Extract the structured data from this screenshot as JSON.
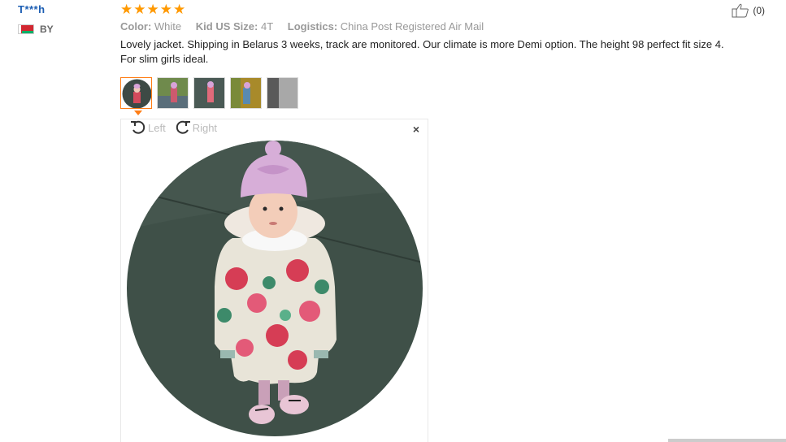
{
  "user": {
    "name": "T***h",
    "country": "BY"
  },
  "rating": {
    "stars": 5
  },
  "attributes": [
    {
      "name": "Color:",
      "value": "White"
    },
    {
      "name": "Kid US Size:",
      "value": "4T"
    },
    {
      "name": "Logistics:",
      "value": "China Post Registered Air Mail"
    }
  ],
  "feedback": {
    "line1": "Lovely jacket. Shipping in Belarus 3 weeks, track are monitored. Our climate is more Demi option. The height 98 perfect fit size 4.",
    "line2": "For slim girls ideal."
  },
  "helpful": {
    "count": "(0)"
  },
  "viewer": {
    "rotate_left": "Left",
    "rotate_right": "Right",
    "close": "×"
  },
  "colors": {
    "star": "#ff9900",
    "active_thumb": "#ff7e16",
    "username": "#1c5eb3"
  },
  "icons": [
    "thumbs-up-icon",
    "rotate-left-icon",
    "rotate-right-icon",
    "close-icon",
    "flag-icon"
  ]
}
